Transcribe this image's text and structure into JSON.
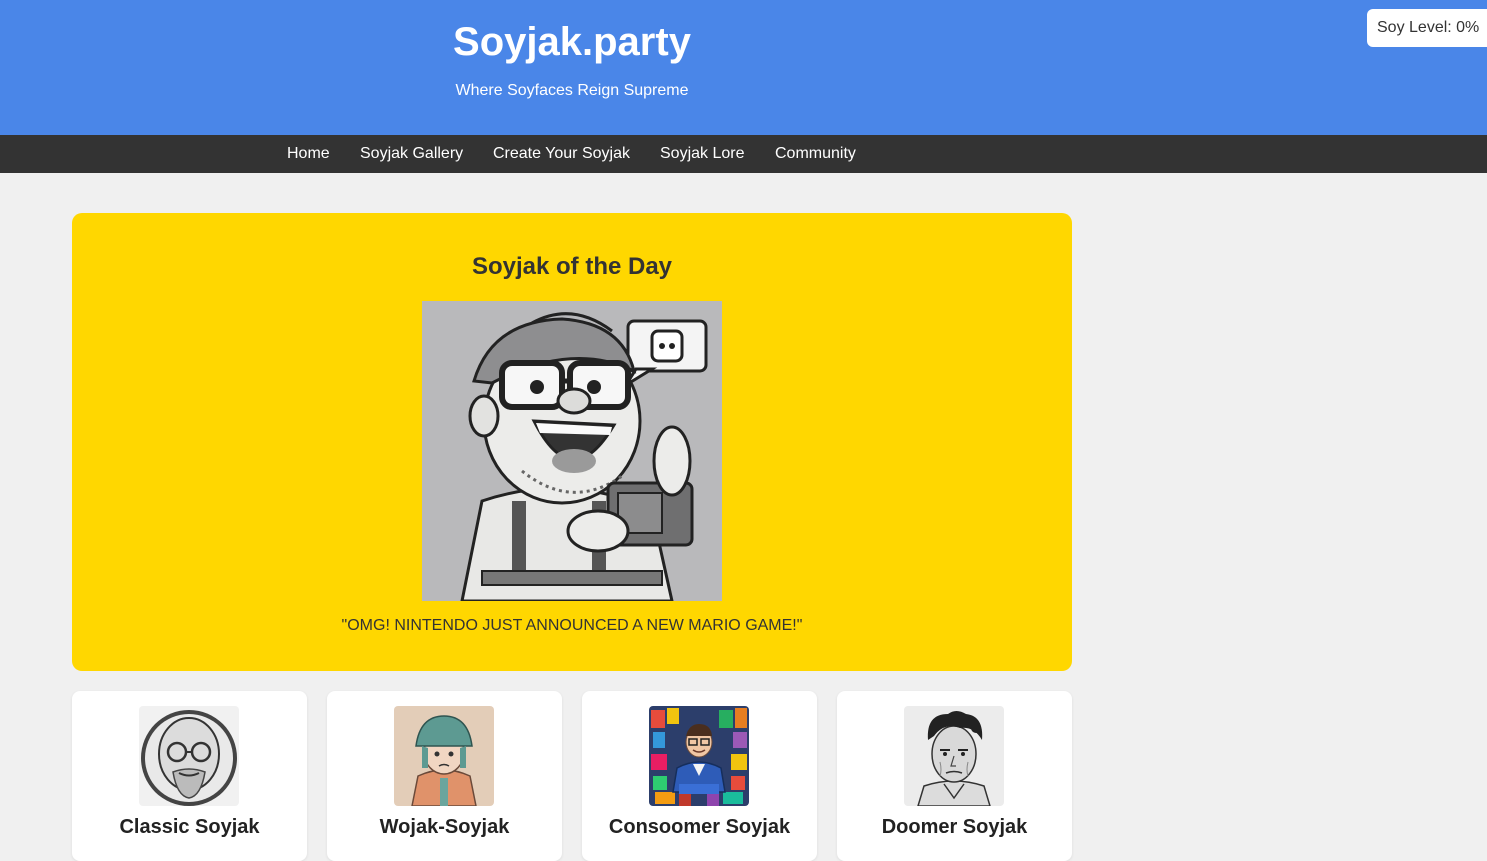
{
  "header": {
    "title": "Soyjak.party",
    "tagline": "Where Soyfaces Reign Supreme",
    "soy_level": "Soy Level: 0%"
  },
  "nav": {
    "items": [
      {
        "label": "Home"
      },
      {
        "label": "Soyjak Gallery"
      },
      {
        "label": "Create Your Soyjak"
      },
      {
        "label": "Soyjak Lore"
      },
      {
        "label": "Community"
      }
    ]
  },
  "soyjak_of_the_day": {
    "title": "Soyjak of the Day",
    "quote": "\"OMG! NINTENDO JUST ANNOUNCED A NEW MARIO GAME!\""
  },
  "cards": [
    {
      "name": "Classic Soyjak"
    },
    {
      "name": "Wojak-Soyjak"
    },
    {
      "name": "Consoomer Soyjak"
    },
    {
      "name": "Doomer Soyjak"
    }
  ],
  "colors": {
    "header_blue": "#4a86e8",
    "nav_dark": "#333333",
    "feature_yellow": "#ffd700",
    "page_bg": "#f0f0f0"
  }
}
